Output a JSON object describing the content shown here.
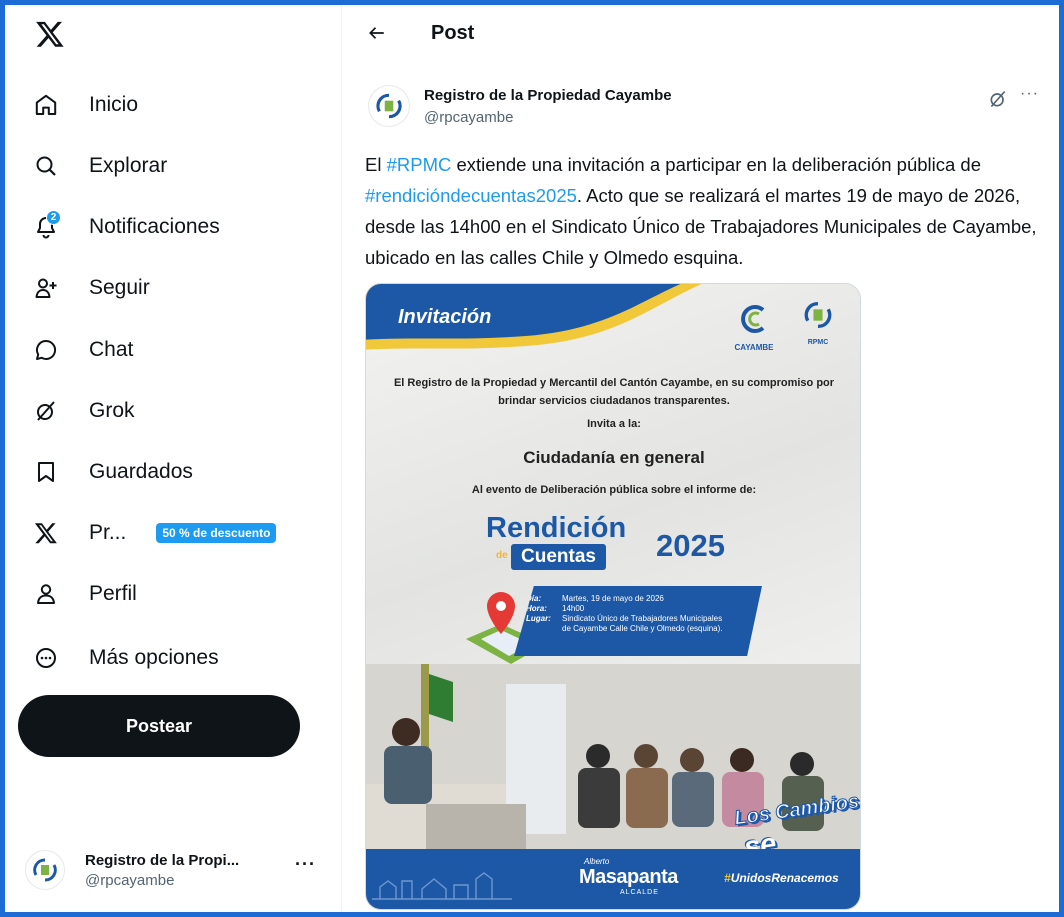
{
  "sidebar": {
    "nav": [
      {
        "label": "Inicio",
        "icon": "home-icon"
      },
      {
        "label": "Explorar",
        "icon": "search-icon"
      },
      {
        "label": "Notificaciones",
        "icon": "bell-icon",
        "badge": "2"
      },
      {
        "label": "Seguir",
        "icon": "follow-icon"
      },
      {
        "label": "Chat",
        "icon": "chat-icon"
      },
      {
        "label": "Grok",
        "icon": "grok-icon"
      },
      {
        "label": "Guardados",
        "icon": "bookmark-icon"
      },
      {
        "label": "Pr...",
        "icon": "x-premium-icon",
        "promo": "50 % de descuento"
      },
      {
        "label": "Perfil",
        "icon": "profile-icon"
      },
      {
        "label": "Más opciones",
        "icon": "more-circle-icon"
      }
    ],
    "post_button": "Postear",
    "account": {
      "name": "Registro de la Propi...",
      "handle": "@rpcayambe",
      "more": "···"
    }
  },
  "main": {
    "title": "Post",
    "author": {
      "name": "Registro de la Propiedad Cayambe",
      "handle": "@rpcayambe"
    },
    "more": "···",
    "text": {
      "p1": "El ",
      "tag1": "#RPMC",
      "p2": " extiende una invitación a participar en la deliberación pública de ",
      "tag2": "#rendicióndecuentas2025",
      "p3": ". Acto que se realizará el martes 19 de mayo de 2026, desde las 14h00 en el Sindicato Único de Trabajadores Municipales de Cayambe, ubicado en las calles Chile y Olmedo esquina."
    }
  },
  "media": {
    "invitacion": "Invitación",
    "logo1_caption": "CAYAMBE",
    "logo2_caption": "RPMC",
    "paragraph": "El Registro de la Propiedad y Mercantil del Cantón Cayambe, en su compromiso por brindar servicios ciudadanos transparentes.",
    "invita": "Invita a la:",
    "ciudadania": "Ciudadanía en general",
    "evento": "Al evento de Deliberación pública sobre el informe de:",
    "rendicion": "Rendición",
    "de": "de",
    "cuentas": "Cuentas",
    "year": "2025",
    "info": {
      "dia_k": "Día:",
      "dia_v": "Martes, 19 de mayo de 2026",
      "hora_k": "Hora:",
      "hora_v": "14h00",
      "lugar_k": "Lugar:",
      "lugar_v": "Sindicato Único de Trabajadores Municipales de Cayambe Calle Chile y Olmedo (esquina)."
    },
    "cambios1": "Los Cambios",
    "cambios2": "se viven",
    "alberto": "Alberto",
    "masapanta": "Masapanta",
    "alcalde": "ALCALDE",
    "unidos_hash": "#",
    "unidos": "UnidosRenacemos"
  },
  "colors": {
    "accent": "#1d9bf0",
    "brand_blue": "#1d58a7",
    "frame": "#1d6bd4",
    "text": "#0f1419",
    "muted": "#536471"
  }
}
